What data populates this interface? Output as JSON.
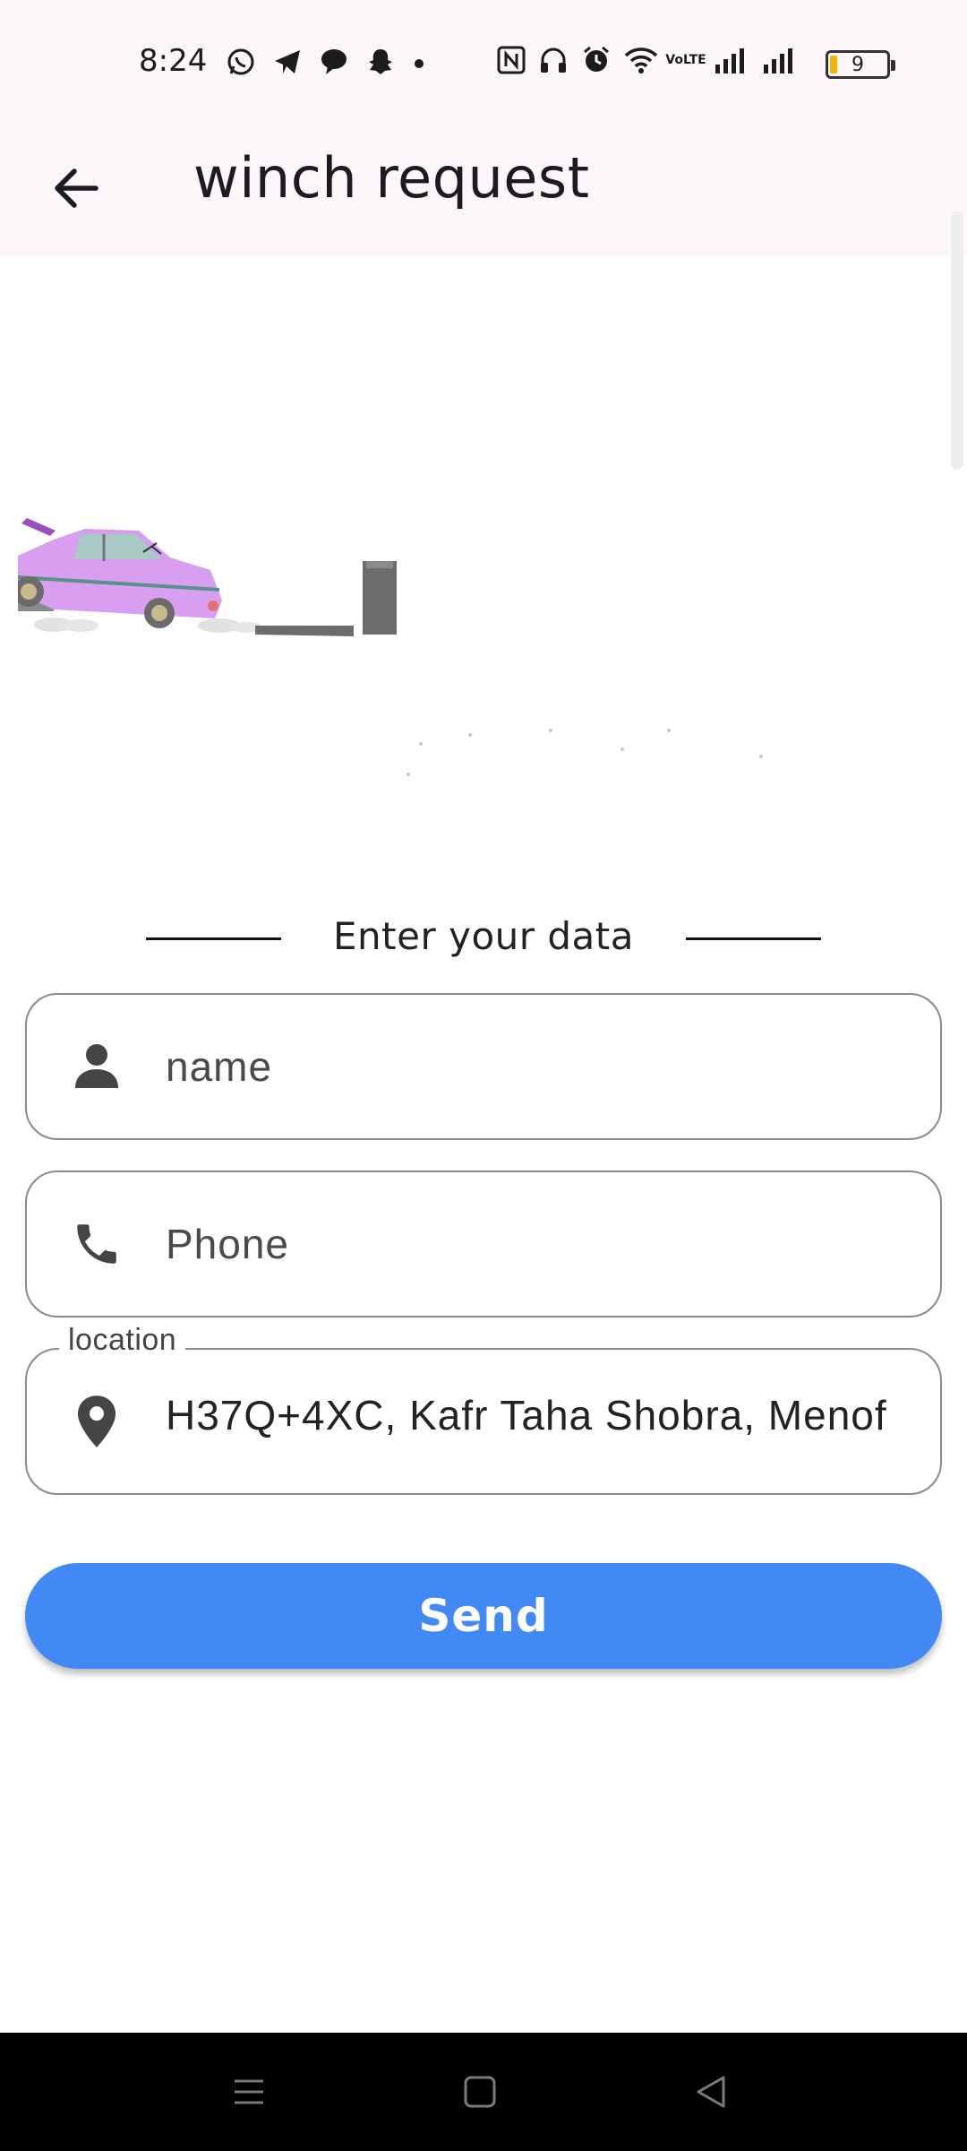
{
  "status_bar": {
    "time": "8:24",
    "battery_level": "9",
    "icons_left": [
      "whatsapp-icon",
      "telegram-icon",
      "chat-bubble-icon",
      "snapchat-icon",
      "dot-icon"
    ],
    "icons_right": [
      "nfc-icon",
      "headphones-icon",
      "alarm-icon",
      "wifi-icon",
      "volte-icon",
      "signal-icon",
      "signal-icon"
    ],
    "volte_text": "VoLTE"
  },
  "app_bar": {
    "title": "winch request",
    "back_icon": "arrow-back-icon"
  },
  "form": {
    "section_label": "Enter your data",
    "name_placeholder": "name",
    "name_icon": "person-icon",
    "phone_placeholder": "Phone",
    "phone_icon": "phone-icon",
    "location_label": "location",
    "location_value": "H37Q+4XC, Kafr Taha Shobra, Menof",
    "location_icon": "location-pin-icon",
    "send_label": "Send"
  },
  "colors": {
    "accent": "#4289f5",
    "app_bar_bg": "#fcf6fb",
    "field_border": "#8b8b8b",
    "car": "#d89ff0"
  },
  "nav_bar": {
    "buttons": [
      "menu-icon",
      "home-icon",
      "back-triangle-icon"
    ]
  }
}
